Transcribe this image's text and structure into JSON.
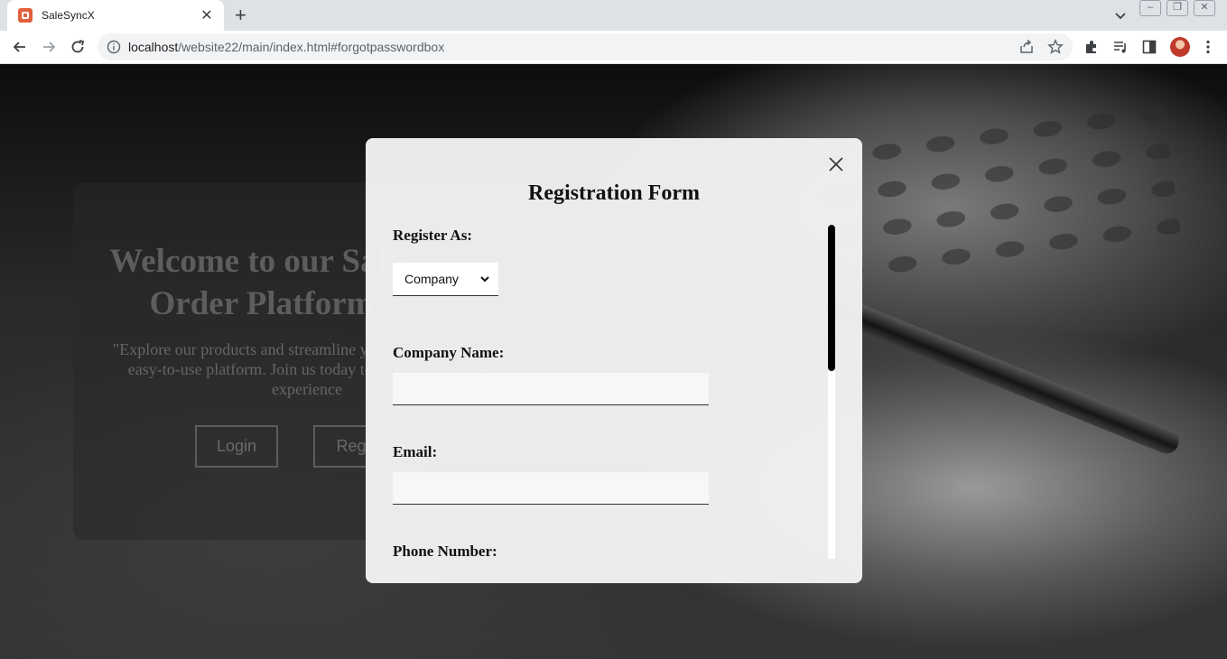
{
  "browser": {
    "tab_title": "SaleSyncX",
    "tab_close": "✕",
    "new_tab": "+",
    "url_host": "localhost",
    "url_path": "/website22/main/index.html#forgotpasswordbox"
  },
  "hero": {
    "title": "Welcome to our Sales Order Platform",
    "description": "\"Explore our products and streamline your process with our easy-to-use platform. Join us today to enjoy a seamless experience",
    "login_label": "Login",
    "register_label": "Register"
  },
  "modal": {
    "title": "Registration Form",
    "register_as_label": "Register As:",
    "register_as_value": "Company",
    "company_name_label": "Company Name:",
    "company_name_value": "",
    "email_label": "Email:",
    "email_value": "",
    "phone_label": "Phone Number:"
  },
  "colors": {
    "modal_bg": "#f2f2f2",
    "scroll_thumb": "#000000"
  },
  "icons": [
    "back-arrow-icon",
    "forward-arrow-icon",
    "reload-icon",
    "info-icon",
    "share-icon",
    "star-icon",
    "extensions-icon",
    "media-icon",
    "side-panel-icon",
    "menu-icon",
    "close-icon",
    "chevron-down-icon"
  ]
}
